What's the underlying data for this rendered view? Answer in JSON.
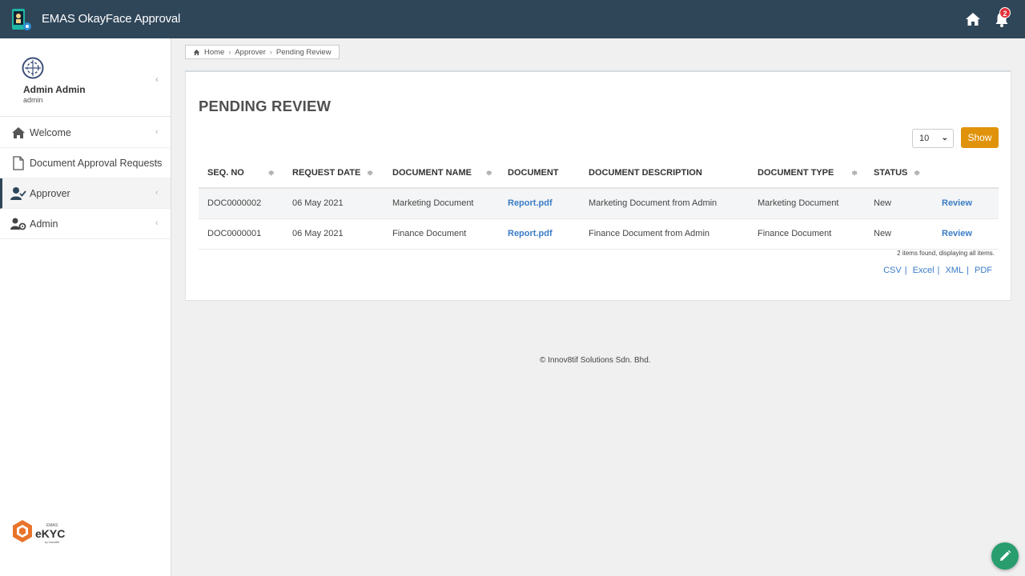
{
  "header": {
    "title": "EMAS OkayFace Approval",
    "notification_count": "2",
    "icons": [
      "app-logo-icon",
      "home-icon",
      "bell-icon"
    ]
  },
  "sidebar": {
    "user": {
      "name": "Admin Admin",
      "role": "admin"
    },
    "items": [
      {
        "label": "Welcome",
        "icon": "home-icon"
      },
      {
        "label": "Document Approval Requests",
        "icon": "file-icon"
      },
      {
        "label": "Approver",
        "icon": "user-check-icon",
        "active": true
      },
      {
        "label": "Admin",
        "icon": "users-cog-icon"
      }
    ],
    "logo": {
      "small": "EMAS",
      "main": "eKYC",
      "tag": "by Innov8tif"
    }
  },
  "breadcrumb": {
    "items": [
      "Home",
      "Approver",
      "Pending Review"
    ]
  },
  "main": {
    "title": "PENDING REVIEW",
    "per_page": "10",
    "show_label": "Show",
    "table": {
      "columns": [
        "SEQ. NO",
        "REQUEST DATE",
        "DOCUMENT NAME",
        "DOCUMENT",
        "DOCUMENT DESCRIPTION",
        "DOCUMENT TYPE",
        "STATUS",
        ""
      ],
      "rows": [
        {
          "seq": "DOC0000002",
          "date": "06 May 2021",
          "name": "Marketing Document",
          "doc": "Report.pdf",
          "desc": "Marketing Document from Admin",
          "type": "Marketing Document",
          "status": "New",
          "action": "Review"
        },
        {
          "seq": "DOC0000001",
          "date": "06 May 2021",
          "name": "Finance Document",
          "doc": "Report.pdf",
          "desc": "Finance Document from Admin",
          "type": "Finance Document",
          "status": "New",
          "action": "Review"
        }
      ]
    },
    "items_found": "2 items found, displaying all items.",
    "exports": [
      "CSV",
      "Excel",
      "XML",
      "PDF"
    ]
  },
  "footer": {
    "text": "© Innov8tif Solutions Sdn. Bhd."
  },
  "colors": {
    "topbar": "#2f4659",
    "accent": "#e0930a",
    "link": "#3a7cc6",
    "badge": "#e0313a",
    "fab": "#2a9d6e"
  }
}
